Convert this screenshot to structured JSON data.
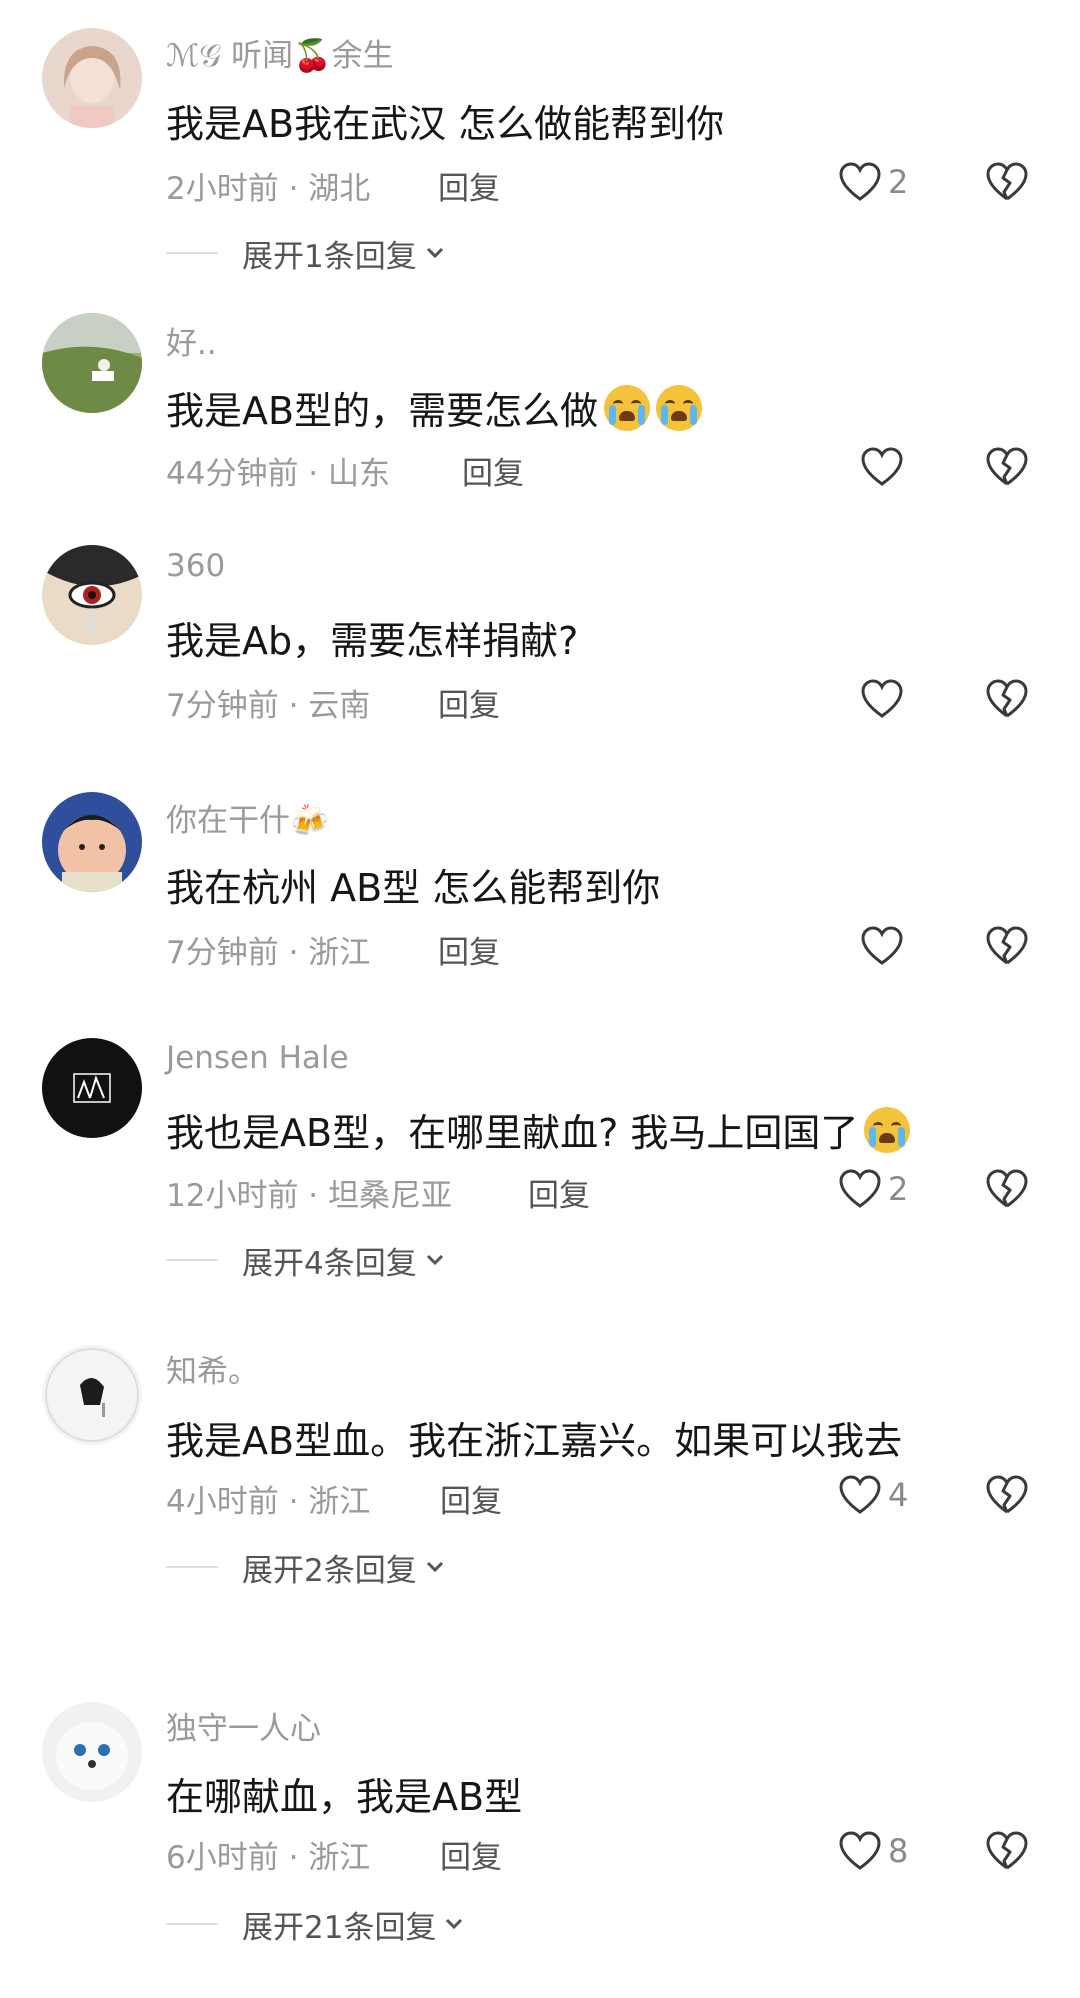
{
  "ui": {
    "reply_label": "回复",
    "colors": {
      "heart_stroke": "#3a3a3a",
      "meta": "#9a9a9a",
      "text": "#161616"
    }
  },
  "comments": [
    {
      "user": "ℳ𝒢 听闻🍒余生",
      "text": "我是AB我在武汉 怎么做能帮到你",
      "time": "2小时前 · 湖北",
      "likes": "2",
      "expand": "展开1条回复"
    },
    {
      "user": "好..",
      "text": "我是AB型的，需要怎么做",
      "time": "44分钟前 · 山东",
      "likes": "",
      "expand": ""
    },
    {
      "user": "360",
      "text": "我是Ab，需要怎样捐献?",
      "time": "7分钟前 · 云南",
      "likes": "",
      "expand": ""
    },
    {
      "user": "你在干什🍻",
      "text": "我在杭州 AB型 怎么能帮到你",
      "time": "7分钟前 · 浙江",
      "likes": "",
      "expand": ""
    },
    {
      "user": "Jensen Hale",
      "text": "我也是AB型，在哪里献血? 我马上回国了",
      "time": "12小时前 · 坦桑尼亚",
      "likes": "2",
      "expand": "展开4条回复"
    },
    {
      "user": "知希。",
      "text": "我是AB型血。我在浙江嘉兴。如果可以我去",
      "time": "4小时前 · 浙江",
      "likes": "4",
      "expand": "展开2条回复"
    },
    {
      "user": "独守一人心",
      "text": "在哪献血，我是AB型",
      "time": "6小时前 · 浙江",
      "likes": "8",
      "expand": "展开21条回复"
    }
  ]
}
